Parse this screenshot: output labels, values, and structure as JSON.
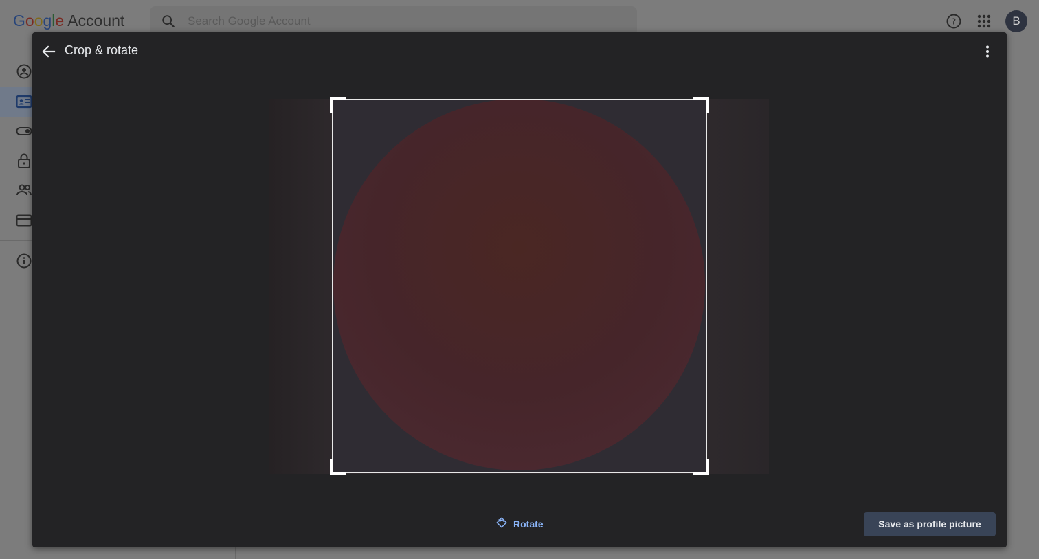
{
  "header": {
    "logo_letters": [
      "G",
      "o",
      "o",
      "g",
      "l",
      "e"
    ],
    "logo_suffix": "Account",
    "search_placeholder": "Search Google Account",
    "avatar_initial": "B"
  },
  "sidebar": {
    "items": [
      {
        "icon": "account-circle-icon"
      },
      {
        "icon": "id-card-icon",
        "active": true
      },
      {
        "icon": "toggle-icon"
      },
      {
        "icon": "lock-icon"
      },
      {
        "icon": "people-icon"
      },
      {
        "icon": "credit-card-icon"
      },
      {
        "icon": "info-icon"
      }
    ]
  },
  "dialog": {
    "title": "Crop & rotate",
    "rotate_label": "Rotate",
    "save_label": "Save as profile picture"
  },
  "colors": {
    "dialog_bg": "#232325",
    "accent_link": "#8ab4f8",
    "save_button_bg": "#394457",
    "photo_circle": "#4a2723"
  }
}
